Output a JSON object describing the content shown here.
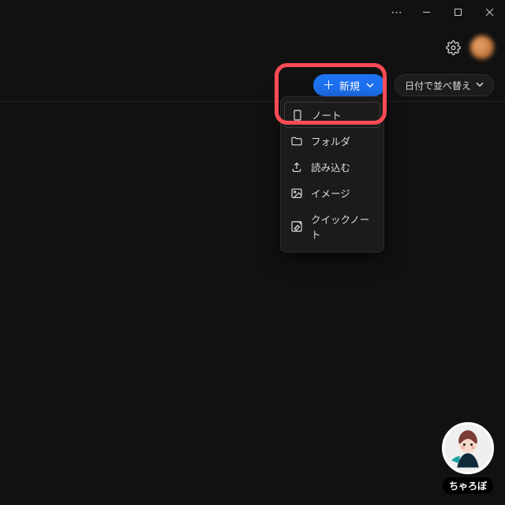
{
  "titlebar": {
    "ellipsis": "⋯"
  },
  "toolbar": {
    "new_label": "新規",
    "sort_label": "日付で並べ替え"
  },
  "dropdown": {
    "items": [
      {
        "icon": "note-icon",
        "label": "ノート"
      },
      {
        "icon": "folder-icon",
        "label": "フォルダ"
      },
      {
        "icon": "import-icon",
        "label": "読み込む"
      },
      {
        "icon": "image-icon",
        "label": "イメージ"
      },
      {
        "icon": "quicknote-icon",
        "label": "クイックノート"
      }
    ]
  },
  "user": {
    "name": "ちゃろぼ"
  }
}
